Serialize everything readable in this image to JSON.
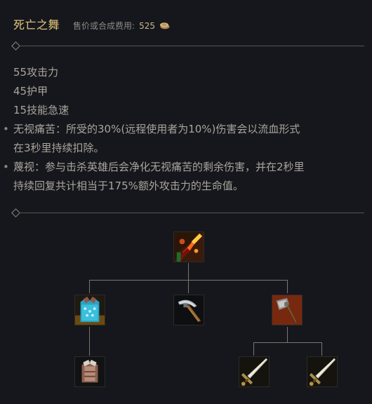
{
  "item": {
    "name": "死亡之舞",
    "cost_label": "售价或合成费用:",
    "cost_value": "525"
  },
  "stats": [
    "55攻击力",
    "45护甲",
    "15技能急速"
  ],
  "passives": [
    {
      "bullet": "•",
      "line1": "无视痛苦：所受的30%(远程使用者为10%)伤害会以流血形式",
      "line2": "在3秒里持续扣除。"
    },
    {
      "bullet": "•",
      "line1": "蔑视：参与击杀英雄后会净化无视痛苦的剩余伤害，并在2秒里",
      "line2": "持续回复共计相当于175%额外攻击力的生命值。"
    }
  ],
  "recipe_tree": {
    "root": "deaths-dance-icon",
    "components": [
      "chain-vest-icon",
      "caulfields-warhammer-icon",
      "pickaxe-icon"
    ],
    "subcomponents": [
      "cloth-armor-icon",
      "long-sword-icon",
      "long-sword-icon"
    ]
  },
  "colors": {
    "background": "#16171d",
    "item_name": "#e4c97a",
    "text": "#a9a59c",
    "divider": "#575650"
  }
}
